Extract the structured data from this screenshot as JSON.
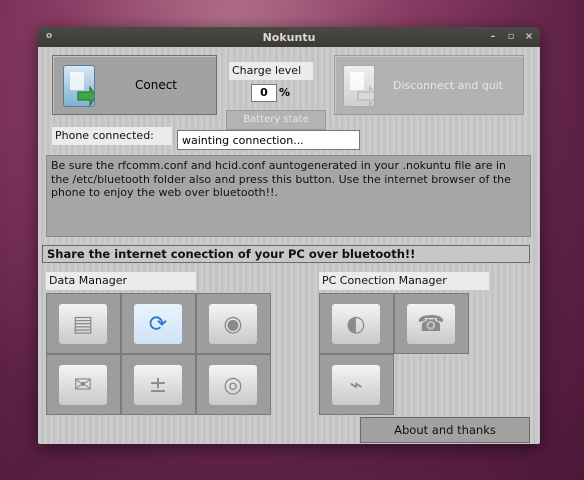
{
  "window": {
    "title": "Nokuntu",
    "menu_glyph": "o",
    "minimize_glyph": "–",
    "maximize_glyph": "▫",
    "close_glyph": "×"
  },
  "connect": {
    "label": "Conect",
    "icon": "phone-connect-icon"
  },
  "charge": {
    "label": "Charge level",
    "value": "0",
    "unit": "%"
  },
  "battery_state_label": "Battery state",
  "disconnect": {
    "label": "Disconnect and quit",
    "icon": "phone-disconnect-icon"
  },
  "phone_connected": {
    "label": "Phone connected:",
    "value": "wainting connection..."
  },
  "instructions": "Be sure the rfcomm.conf and hcid.conf auntogenerated in your .nokuntu file are in the /etc/bluetooth folder also and press this button. Use the internet browser of the phone to enjoy the web over bluetooth!!.",
  "share_banner": "Share the internet conection of your PC over bluetooth!!",
  "data_manager": {
    "title": "Data Manager",
    "tiles": [
      {
        "icon": "file-cabinet-icon",
        "glyph": "▤"
      },
      {
        "icon": "sync-icon",
        "glyph": "⟳"
      },
      {
        "icon": "speaker-icon",
        "glyph": "◉"
      },
      {
        "icon": "mail-icon",
        "glyph": "✉"
      },
      {
        "icon": "calculator-icon",
        "glyph": "±"
      },
      {
        "icon": "disc-search-icon",
        "glyph": "◎"
      }
    ]
  },
  "pc_manager": {
    "title": "PC Conection Manager",
    "tiles": [
      {
        "icon": "globe-icon",
        "glyph": "◐"
      },
      {
        "icon": "phone-fax-icon",
        "glyph": "☎"
      },
      {
        "icon": "usb-cable-icon",
        "glyph": "⌁"
      }
    ]
  },
  "about_label": "About and thanks",
  "colors": {
    "panel": "#c9c9c9",
    "button": "#a2a2a2",
    "selected_tile_accent": "#2a78c6"
  }
}
